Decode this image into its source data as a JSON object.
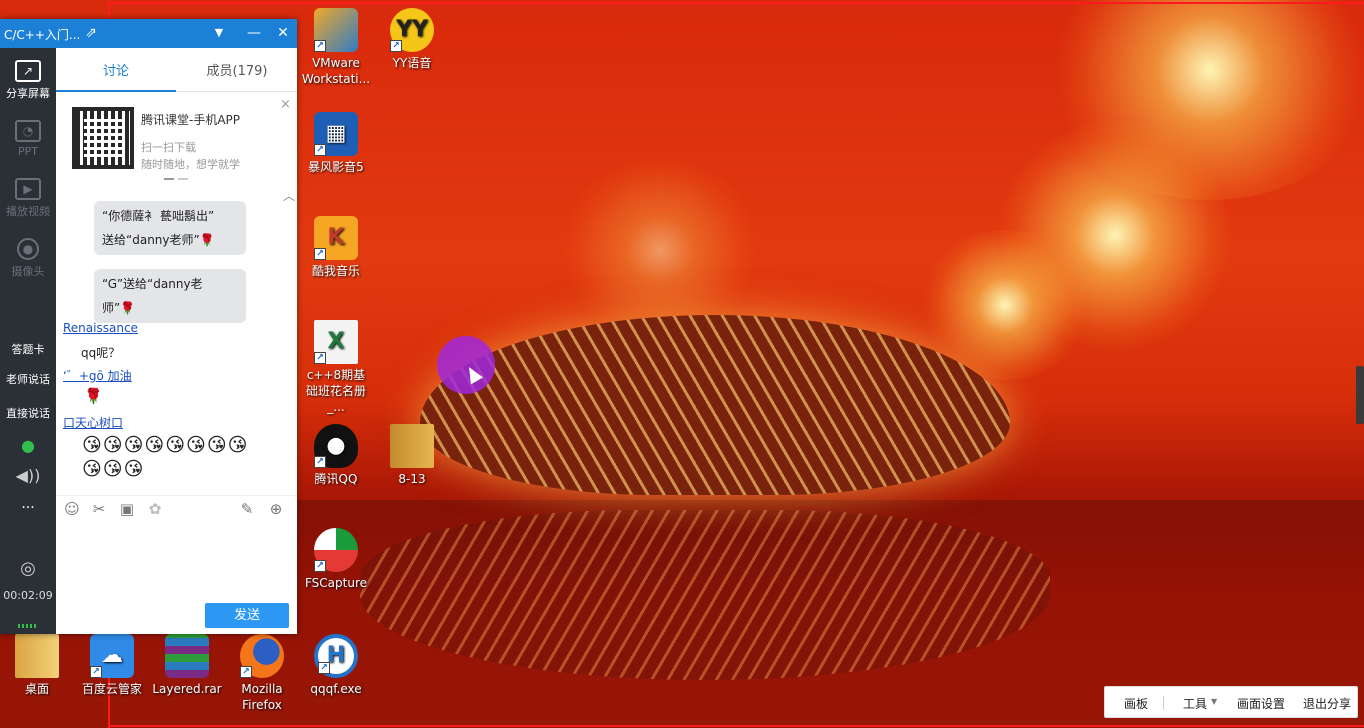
{
  "colors": {
    "accent": "#1b80d6",
    "send": "#2d98f3",
    "sidebar": "#2b2f36",
    "recording_frame": "#ff1b1b"
  },
  "chat_window": {
    "title": "C/C++入门...",
    "tabs": [
      "讨论",
      "成员(179)"
    ],
    "promo": {
      "title": "腾讯课堂-手机APP",
      "line1": "扫一扫下载",
      "line2": "随时随地，想学就学",
      "close": "×"
    },
    "collapse_glyph": "︿",
    "messages": {
      "bubble1_line1": "“你德薩衤 甆咄鬍出”",
      "bubble1_line2": "送给“danny老师”🌹",
      "bubble2_line1": "“G”送给“danny老",
      "bubble2_line2": "师”🌹",
      "sender1": "Renaissance",
      "text1": "qq呢？",
      "sender2": "‘゛+gō 加油",
      "rose": "🌹",
      "sender3": "口天心树口",
      "emoji_row1": "😘😘😘😘😘😘😘😘",
      "emoji_row2": "😘😘😘"
    },
    "send_label": "发送"
  },
  "sidebar": {
    "share_screen": "分享屏幕",
    "ppt": "PPT",
    "play_video": "播放视频",
    "camera": "摄像头",
    "answer_card": "答题卡",
    "teacher_speak": "老师说话",
    "direct_speak": "直接说话",
    "more": "...",
    "timer": "00:02:09"
  },
  "desktop_icons": {
    "vmware": "VMware Workstati...",
    "yy": "YY语音",
    "baofeng": "暴风影音5",
    "kuwo": "酷我音乐",
    "excel_file": "c++8期基础班花名册_...",
    "tencent_qq": "腾讯QQ",
    "folder_813": "8-13",
    "fscapture": "FSCapture",
    "desktop": "桌面",
    "baidu_cloud": "百度云管家",
    "layered_rar": "Layered.rar",
    "firefox": "Mozilla Firefox",
    "qqqf": "qqqf.exe"
  },
  "share_toolbar": {
    "whiteboard": "画板",
    "tools": "工具",
    "screen_settings": "画面设置",
    "exit_share": "退出分享"
  }
}
